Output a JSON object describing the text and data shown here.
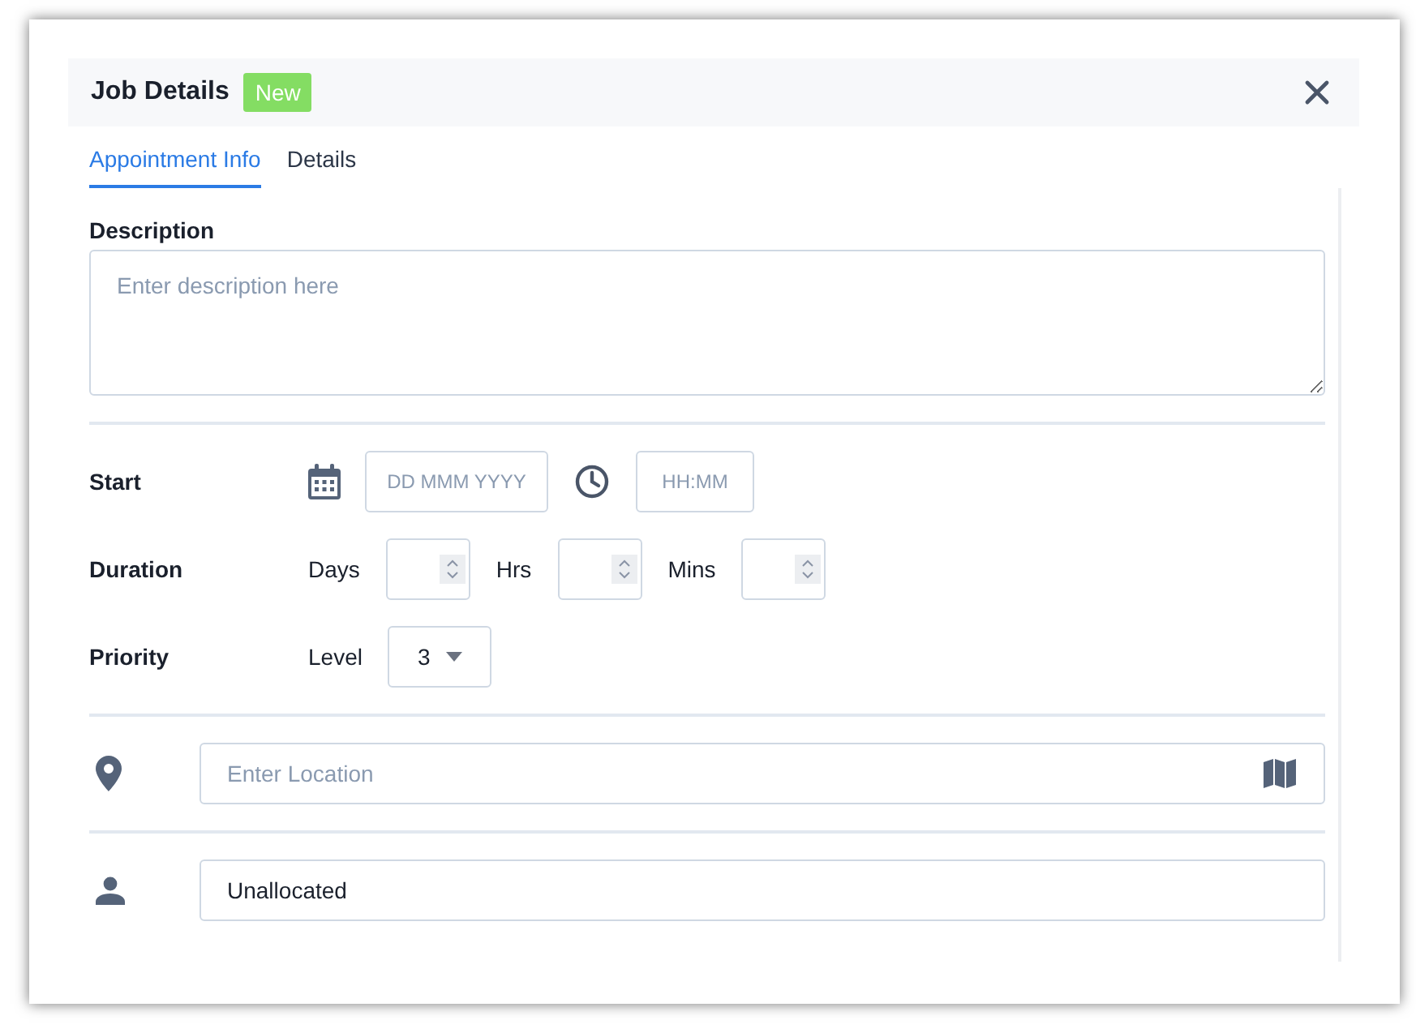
{
  "dialog": {
    "title": "Job Details",
    "badge": "New"
  },
  "tabs": [
    {
      "label": "Appointment Info",
      "selected": true
    },
    {
      "label": "Details",
      "selected": false
    }
  ],
  "description": {
    "label": "Description",
    "placeholder": "Enter description here"
  },
  "start": {
    "label": "Start",
    "date_placeholder": "DD MMM YYYY",
    "time_placeholder": "HH:MM"
  },
  "duration": {
    "label": "Duration",
    "fields": [
      {
        "label": "Days"
      },
      {
        "label": "Hrs"
      },
      {
        "label": "Mins"
      }
    ]
  },
  "priority": {
    "label": "Priority",
    "field_label": "Level",
    "value": "3"
  },
  "location": {
    "placeholder": "Enter Location"
  },
  "assignee": {
    "value": "Unallocated"
  }
}
